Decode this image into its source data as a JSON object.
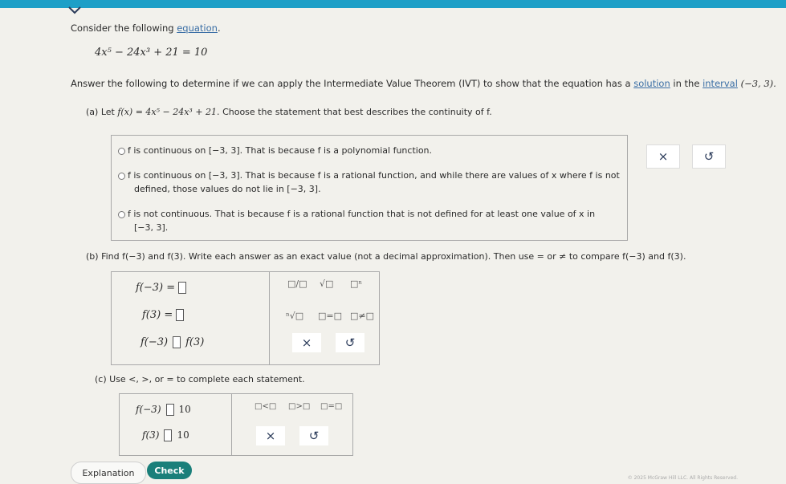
{
  "header": {
    "intro": "Consider the following",
    "intro_link": "equation",
    "intro_end": "."
  },
  "equation": {
    "text": "4x⁵ − 24x³ + 21 = 10"
  },
  "instruction": {
    "prefix": "Answer the following to determine if we can apply the Intermediate Value Theorem (IVT) to show that the equation has a",
    "solution_link": "solution",
    "middle": "in the",
    "interval_link": "interval",
    "interval": "(−3, 3)."
  },
  "part_a": {
    "label": "(a)",
    "let": "Let",
    "func": "f(x) = 4x⁵ − 24x³ + 21.",
    "prompt": "Choose the statement that best describes the continuity of f.",
    "options": [
      {
        "line1": "f is continuous on [−3, 3]. That is because f is a polynomial function.",
        "line2": ""
      },
      {
        "line1": "f is continuous on [−3, 3]. That is because f is a rational function, and while there are values of x where f is not",
        "line2": "defined, those values do not lie in [−3, 3]."
      },
      {
        "line1": "f is not continuous. That is because f is a rational function that is not defined for at least one value of x in",
        "line2": "[−3, 3]."
      }
    ],
    "clear_icon": "×",
    "undo_icon": "↺"
  },
  "part_b": {
    "label": "(b)",
    "prompt": "Find f(−3) and f(3). Write each answer as an exact value (not a decimal approximation). Then use = or ≠ to compare f(−3) and f(3).",
    "rows": [
      "f(−3) =",
      "f(3) =",
      "f(−3)",
      "f(3)"
    ],
    "tools": {
      "frac": "□/□",
      "sqrt": "√□",
      "power": "□ⁿ",
      "nthroot": "ⁿ√□",
      "eq": "□=□",
      "neq": "□≠□"
    },
    "clear_icon": "×",
    "undo_icon": "↺"
  },
  "part_c": {
    "label": "(c)",
    "prompt": "Use <, >, or = to complete each statement.",
    "rows": [
      {
        "left": "f(−3)",
        "right": "10"
      },
      {
        "left": "f(3)",
        "right": "10"
      }
    ],
    "tools": {
      "lt": "□<□",
      "gt": "□>□",
      "eq": "□=□"
    },
    "clear_icon": "×",
    "undo_icon": "↺"
  },
  "footer": {
    "explanation": "Explanation",
    "check": "Check",
    "copyright": "© 2025 McGraw Hill LLC. All Rights Reserved."
  },
  "colors": {
    "accent": "#1d9fc7",
    "check": "#1a7f7a",
    "link": "#3a6ea5"
  }
}
